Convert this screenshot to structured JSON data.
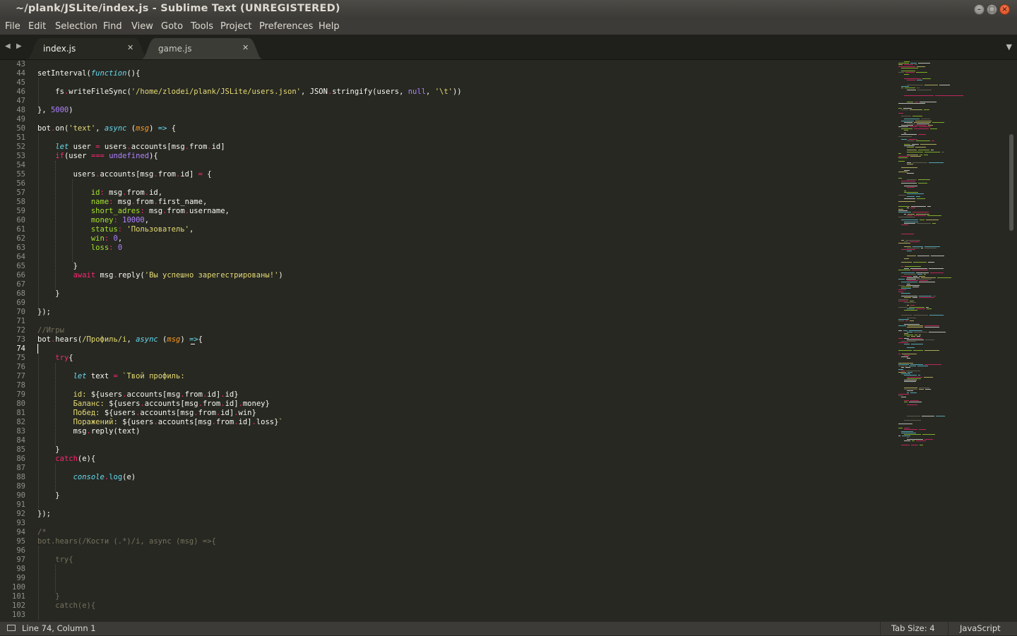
{
  "window": {
    "title": "~/plank/JSLite/index.js - Sublime Text (UNREGISTERED)"
  },
  "menu": [
    "File",
    "Edit",
    "Selection",
    "Find",
    "View",
    "Goto",
    "Tools",
    "Project",
    "Preferences",
    "Help"
  ],
  "tabs": [
    {
      "label": "index.js",
      "active": true
    },
    {
      "label": "game.js",
      "active": false
    }
  ],
  "icons": {
    "nav_prev": "triangle-left",
    "nav_next": "triangle-right",
    "tab_close": "x",
    "tab_menu": "triangle-down",
    "status_panel": "panel-icon",
    "win_minimize": "minimize",
    "win_maximize": "maximize",
    "win_close": "close"
  },
  "colors": {
    "background": "#272822",
    "plain": "#f8f8f2",
    "keyword": "#f92672",
    "function": "#a6e22e",
    "string": "#e6db74",
    "number": "#ae81ff",
    "builtin": "#66d9ef",
    "comment": "#75715e",
    "param": "#fd971f"
  },
  "editor": {
    "first_line": 43,
    "current_line": 74,
    "lines": [
      {
        "n": "43",
        "t": []
      },
      {
        "n": "44",
        "t": [
          [
            "p",
            "setInterval("
          ],
          [
            "bi",
            "function"
          ],
          [
            "p",
            "(){"
          ]
        ]
      },
      {
        "n": "45",
        "t": []
      },
      {
        "n": "46",
        "t": [
          [
            "p",
            "    fs"
          ],
          [
            "k",
            "."
          ],
          [
            "p",
            "writeFileSync("
          ],
          [
            "s",
            "'/home/zlodei/plank/JSLite/users.json'"
          ],
          [
            "p",
            ", JSON"
          ],
          [
            "k",
            "."
          ],
          [
            "p",
            "stringify(users, "
          ],
          [
            "n",
            "null"
          ],
          [
            "p",
            ", "
          ],
          [
            "s",
            "'\\t'"
          ],
          [
            "p",
            "))"
          ]
        ]
      },
      {
        "n": "47",
        "t": []
      },
      {
        "n": "48",
        "t": [
          [
            "p",
            "}, "
          ],
          [
            "n",
            "5000"
          ],
          [
            "p",
            ")"
          ]
        ]
      },
      {
        "n": "49",
        "t": []
      },
      {
        "n": "50",
        "t": [
          [
            "p",
            "bot"
          ],
          [
            "k",
            "."
          ],
          [
            "p",
            "on("
          ],
          [
            "s",
            "'text'"
          ],
          [
            "p",
            ", "
          ],
          [
            "bi",
            "async"
          ],
          [
            "p",
            " ("
          ],
          [
            "pa",
            "msg"
          ],
          [
            "p",
            ") "
          ],
          [
            "b",
            "=>"
          ],
          [
            "p",
            " {"
          ]
        ]
      },
      {
        "n": "51",
        "t": []
      },
      {
        "n": "52",
        "t": [
          [
            "p",
            "    "
          ],
          [
            "bi",
            "let"
          ],
          [
            "p",
            " user "
          ],
          [
            "k",
            "="
          ],
          [
            "p",
            " users"
          ],
          [
            "k",
            "."
          ],
          [
            "p",
            "accounts[msg"
          ],
          [
            "k",
            "."
          ],
          [
            "p",
            "from"
          ],
          [
            "k",
            "."
          ],
          [
            "p",
            "id]"
          ]
        ]
      },
      {
        "n": "53",
        "t": [
          [
            "p",
            "    "
          ],
          [
            "k",
            "if"
          ],
          [
            "p",
            "(user "
          ],
          [
            "k",
            "==="
          ],
          [
            "p",
            " "
          ],
          [
            "n",
            "undefined"
          ],
          [
            "p",
            "){"
          ]
        ]
      },
      {
        "n": "54",
        "t": []
      },
      {
        "n": "55",
        "t": [
          [
            "p",
            "        users"
          ],
          [
            "k",
            "."
          ],
          [
            "p",
            "accounts[msg"
          ],
          [
            "k",
            "."
          ],
          [
            "p",
            "from"
          ],
          [
            "k",
            "."
          ],
          [
            "p",
            "id] "
          ],
          [
            "k",
            "="
          ],
          [
            "p",
            " {"
          ]
        ]
      },
      {
        "n": "56",
        "t": []
      },
      {
        "n": "57",
        "t": [
          [
            "p",
            "            "
          ],
          [
            "f",
            "id"
          ],
          [
            "k",
            ":"
          ],
          [
            "p",
            " msg"
          ],
          [
            "k",
            "."
          ],
          [
            "p",
            "from"
          ],
          [
            "k",
            "."
          ],
          [
            "p",
            "id,"
          ]
        ]
      },
      {
        "n": "58",
        "t": [
          [
            "p",
            "            "
          ],
          [
            "f",
            "name"
          ],
          [
            "k",
            ":"
          ],
          [
            "p",
            " msg"
          ],
          [
            "k",
            "."
          ],
          [
            "p",
            "from"
          ],
          [
            "k",
            "."
          ],
          [
            "p",
            "first_name,"
          ]
        ]
      },
      {
        "n": "59",
        "t": [
          [
            "p",
            "            "
          ],
          [
            "f",
            "short_adres"
          ],
          [
            "k",
            ":"
          ],
          [
            "p",
            " msg"
          ],
          [
            "k",
            "."
          ],
          [
            "p",
            "from"
          ],
          [
            "k",
            "."
          ],
          [
            "p",
            "username,"
          ]
        ]
      },
      {
        "n": "60",
        "t": [
          [
            "p",
            "            "
          ],
          [
            "f",
            "money"
          ],
          [
            "k",
            ":"
          ],
          [
            "p",
            " "
          ],
          [
            "n",
            "10000"
          ],
          [
            "p",
            ","
          ]
        ]
      },
      {
        "n": "61",
        "t": [
          [
            "p",
            "            "
          ],
          [
            "f",
            "status"
          ],
          [
            "k",
            ":"
          ],
          [
            "p",
            " "
          ],
          [
            "s",
            "'Пользователь'"
          ],
          [
            "p",
            ","
          ]
        ]
      },
      {
        "n": "62",
        "t": [
          [
            "p",
            "            "
          ],
          [
            "f",
            "win"
          ],
          [
            "k",
            ":"
          ],
          [
            "p",
            " "
          ],
          [
            "n",
            "0"
          ],
          [
            "p",
            ","
          ]
        ]
      },
      {
        "n": "63",
        "t": [
          [
            "p",
            "            "
          ],
          [
            "f",
            "loss"
          ],
          [
            "k",
            ":"
          ],
          [
            "p",
            " "
          ],
          [
            "n",
            "0"
          ]
        ]
      },
      {
        "n": "64",
        "t": []
      },
      {
        "n": "65",
        "t": [
          [
            "p",
            "        }"
          ]
        ]
      },
      {
        "n": "66",
        "t": [
          [
            "p",
            "        "
          ],
          [
            "k",
            "await"
          ],
          [
            "p",
            " msg"
          ],
          [
            "k",
            "."
          ],
          [
            "p",
            "reply("
          ],
          [
            "s",
            "'Вы успешно зарегестрированы!'"
          ],
          [
            "p",
            ")"
          ]
        ]
      },
      {
        "n": "67",
        "t": []
      },
      {
        "n": "68",
        "t": [
          [
            "p",
            "    }"
          ]
        ]
      },
      {
        "n": "69",
        "t": []
      },
      {
        "n": "70",
        "t": [
          [
            "p",
            "});"
          ]
        ]
      },
      {
        "n": "71",
        "t": []
      },
      {
        "n": "72",
        "t": [
          [
            "c",
            "//Игры"
          ]
        ]
      },
      {
        "n": "73",
        "t": [
          [
            "p",
            "bot"
          ],
          [
            "k",
            "."
          ],
          [
            "p",
            "hears("
          ],
          [
            "s",
            "/Профиль/i"
          ],
          [
            "p",
            ", "
          ],
          [
            "bi",
            "async"
          ],
          [
            "p",
            " ("
          ],
          [
            "pa",
            "msg"
          ],
          [
            "p",
            ") "
          ],
          [
            "b",
            "=>"
          ],
          [
            "p",
            "{"
          ]
        ]
      },
      {
        "n": "74",
        "t": []
      },
      {
        "n": "75",
        "t": [
          [
            "p",
            "    "
          ],
          [
            "k",
            "try"
          ],
          [
            "p",
            "{"
          ]
        ]
      },
      {
        "n": "76",
        "t": []
      },
      {
        "n": "77",
        "t": [
          [
            "p",
            "        "
          ],
          [
            "bi",
            "let"
          ],
          [
            "p",
            " text "
          ],
          [
            "k",
            "="
          ],
          [
            "p",
            " "
          ],
          [
            "s",
            "`Твой профиль:"
          ]
        ]
      },
      {
        "n": "78",
        "t": []
      },
      {
        "n": "79",
        "t": [
          [
            "s",
            "        id: "
          ],
          [
            "p",
            "${users"
          ],
          [
            "k",
            "."
          ],
          [
            "p",
            "accounts[msg"
          ],
          [
            "k",
            "."
          ],
          [
            "p",
            "from"
          ],
          [
            "k",
            "."
          ],
          [
            "p",
            "id]"
          ],
          [
            "k",
            "."
          ],
          [
            "p",
            "id}"
          ]
        ]
      },
      {
        "n": "80",
        "t": [
          [
            "s",
            "        Баланс: "
          ],
          [
            "p",
            "${users"
          ],
          [
            "k",
            "."
          ],
          [
            "p",
            "accounts[msg"
          ],
          [
            "k",
            "."
          ],
          [
            "p",
            "from"
          ],
          [
            "k",
            "."
          ],
          [
            "p",
            "id]"
          ],
          [
            "k",
            "."
          ],
          [
            "p",
            "money}"
          ]
        ]
      },
      {
        "n": "81",
        "t": [
          [
            "s",
            "        Побед: "
          ],
          [
            "p",
            "${users"
          ],
          [
            "k",
            "."
          ],
          [
            "p",
            "accounts[msg"
          ],
          [
            "k",
            "."
          ],
          [
            "p",
            "from"
          ],
          [
            "k",
            "."
          ],
          [
            "p",
            "id]"
          ],
          [
            "k",
            "."
          ],
          [
            "p",
            "win}"
          ]
        ]
      },
      {
        "n": "82",
        "t": [
          [
            "s",
            "        Поражений: "
          ],
          [
            "p",
            "${users"
          ],
          [
            "k",
            "."
          ],
          [
            "p",
            "accounts[msg"
          ],
          [
            "k",
            "."
          ],
          [
            "p",
            "from"
          ],
          [
            "k",
            "."
          ],
          [
            "p",
            "id]"
          ],
          [
            "k",
            "."
          ],
          [
            "p",
            "loss}"
          ],
          [
            "s",
            "`"
          ]
        ]
      },
      {
        "n": "83",
        "t": [
          [
            "p",
            "        msg"
          ],
          [
            "k",
            "."
          ],
          [
            "p",
            "reply(text)"
          ]
        ]
      },
      {
        "n": "84",
        "t": []
      },
      {
        "n": "85",
        "t": [
          [
            "p",
            "    }"
          ]
        ]
      },
      {
        "n": "86",
        "t": [
          [
            "p",
            "    "
          ],
          [
            "k",
            "catch"
          ],
          [
            "p",
            "(e){"
          ]
        ]
      },
      {
        "n": "87",
        "t": []
      },
      {
        "n": "88",
        "t": [
          [
            "p",
            "        "
          ],
          [
            "bi",
            "console"
          ],
          [
            "k",
            "."
          ],
          [
            "b",
            "log"
          ],
          [
            "p",
            "(e)"
          ]
        ]
      },
      {
        "n": "89",
        "t": []
      },
      {
        "n": "90",
        "t": [
          [
            "p",
            "    }"
          ]
        ]
      },
      {
        "n": "91",
        "t": []
      },
      {
        "n": "92",
        "t": [
          [
            "p",
            "});"
          ]
        ]
      },
      {
        "n": "93",
        "t": []
      },
      {
        "n": "94",
        "t": [
          [
            "c",
            "/*"
          ]
        ]
      },
      {
        "n": "95",
        "t": [
          [
            "c",
            "bot.hears(/Кости (.*)/i, async (msg) =>{"
          ]
        ]
      },
      {
        "n": "96",
        "t": []
      },
      {
        "n": "97",
        "t": [
          [
            "c",
            "    try{"
          ]
        ]
      },
      {
        "n": "98",
        "t": []
      },
      {
        "n": "99",
        "t": []
      },
      {
        "n": "100",
        "t": []
      },
      {
        "n": "101",
        "t": [
          [
            "c",
            "    }"
          ]
        ]
      },
      {
        "n": "102",
        "t": [
          [
            "c",
            "    catch(e){"
          ]
        ]
      },
      {
        "n": "103",
        "t": []
      }
    ]
  },
  "status": {
    "position": "Line 74, Column 1",
    "tab_size": "Tab Size: 4",
    "syntax": "JavaScript"
  }
}
